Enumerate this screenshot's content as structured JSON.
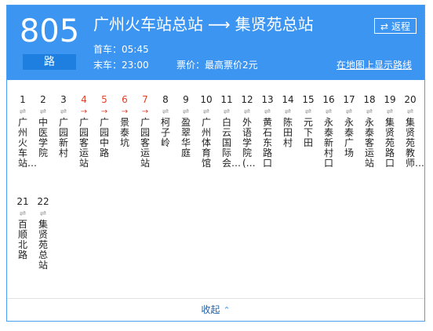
{
  "header": {
    "route_number": "805",
    "route_suffix": "路",
    "origin": "广州火车站总站",
    "arrow": "⟶",
    "destination": "集贤苑总站",
    "return_icon": "⇄",
    "return_label": "返程",
    "first_bus": "首车：05:45",
    "last_bus": "末车：23:00",
    "fare": "票价：最高票价2元",
    "map_link": "在地图上显示路线"
  },
  "colors": {
    "header_bg": "#3d95f2",
    "highlight": "#e0402a",
    "link": "#1a5fa8"
  },
  "stops": [
    {
      "num": "1",
      "name": "广州火车站…",
      "hl": false
    },
    {
      "num": "2",
      "name": "中医学院",
      "hl": false
    },
    {
      "num": "3",
      "name": "广园新村",
      "hl": false
    },
    {
      "num": "4",
      "name": "广园客运站",
      "hl": true
    },
    {
      "num": "5",
      "name": "广园中路",
      "hl": true
    },
    {
      "num": "6",
      "name": "景泰坑",
      "hl": true
    },
    {
      "num": "7",
      "name": "广园客运站",
      "hl": true
    },
    {
      "num": "8",
      "name": "柯子岭",
      "hl": false
    },
    {
      "num": "9",
      "name": "盈翠华庭",
      "hl": false
    },
    {
      "num": "10",
      "name": "广州体育馆",
      "hl": false
    },
    {
      "num": "11",
      "name": "白云国际会…",
      "hl": false
    },
    {
      "num": "12",
      "name": "外语学院(…",
      "hl": false
    },
    {
      "num": "13",
      "name": "黄石东路口",
      "hl": false
    },
    {
      "num": "14",
      "name": "陈田村",
      "hl": false
    },
    {
      "num": "15",
      "name": "元下田",
      "hl": false
    },
    {
      "num": "16",
      "name": "永泰新村口",
      "hl": false
    },
    {
      "num": "17",
      "name": "永泰广场",
      "hl": false
    },
    {
      "num": "18",
      "name": "永泰客运站",
      "hl": false
    },
    {
      "num": "19",
      "name": "集贤苑路口",
      "hl": false
    },
    {
      "num": "20",
      "name": "集贤苑教师…",
      "hl": false
    },
    {
      "num": "21",
      "name": "百顺北路",
      "hl": false
    },
    {
      "num": "22",
      "name": "集贤苑总站",
      "hl": false
    }
  ],
  "stop_dir_both": "⇌",
  "stop_dir_one": "→",
  "collapse": {
    "label": "收起",
    "icon": "⌃"
  }
}
